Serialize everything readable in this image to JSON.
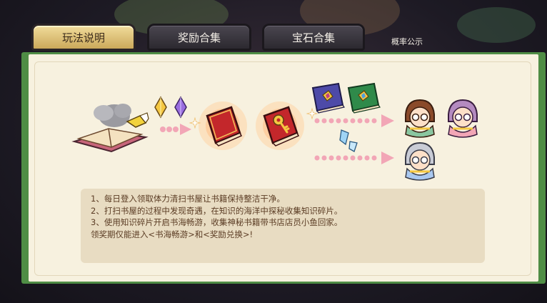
{
  "tabs": [
    {
      "label": "玩法说明",
      "active": true
    },
    {
      "label": "奖励合集",
      "active": false
    },
    {
      "label": "宝石合集",
      "active": false
    }
  ],
  "probability_link": "概率公示",
  "description": {
    "lines": [
      "1、每日登入领取体力清扫书屋让书籍保持整洁干净。",
      "2、打扫书屋的过程中发现奇遇，在知识的海洋中探秘收集知识碎片。",
      "3、使用知识碎片开启书海畅游，收集神秘书籍带书店店员小鱼回家。",
      "领奖期仅能进入<书海畅游>和<奖励兑换>!"
    ]
  },
  "colors": {
    "panel_green": "#4f8d45",
    "panel_cream": "#f7f1df",
    "text_brown": "#5b3c24",
    "arrow_pink": "#f2a6b6"
  }
}
